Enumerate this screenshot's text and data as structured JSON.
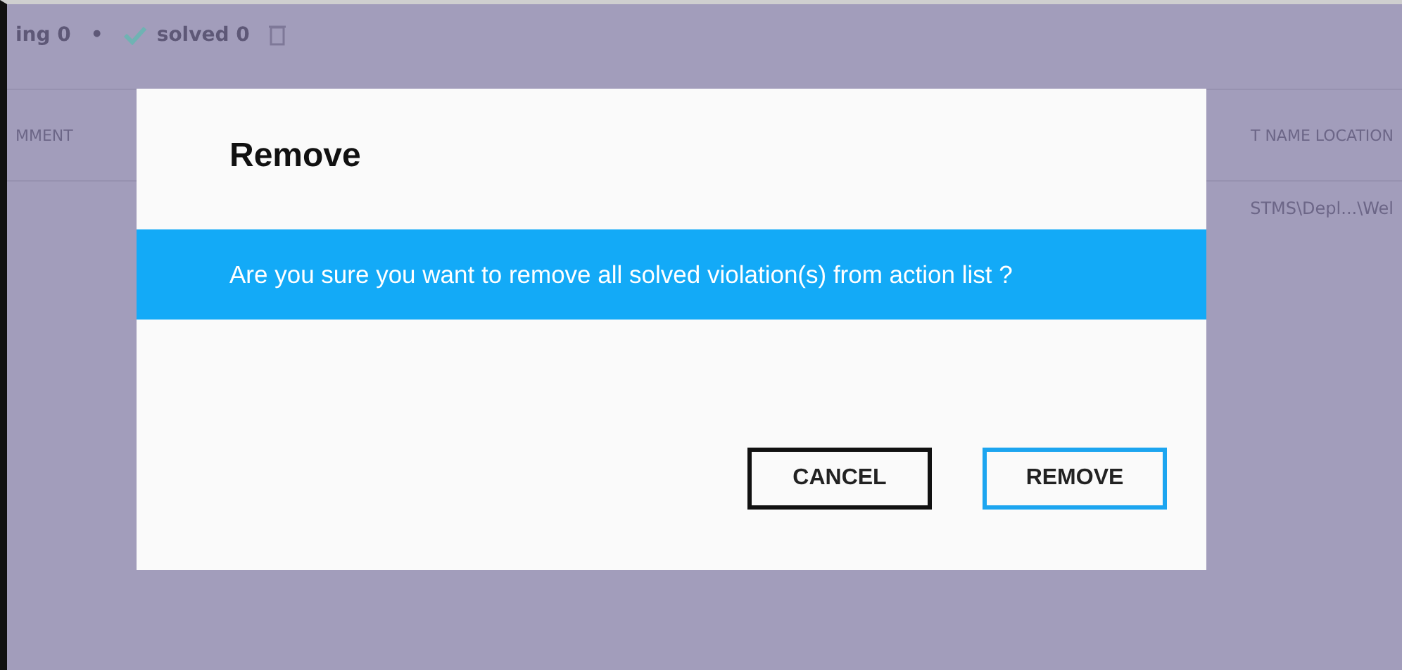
{
  "background": {
    "toolbar": [
      {
        "kind": "count",
        "label": "ing 0"
      },
      {
        "kind": "dot",
        "label": "•"
      },
      {
        "kind": "check",
        "label": "solved 0"
      },
      {
        "kind": "trash"
      }
    ],
    "columns": [
      "MMENT",
      "T NAME LOCATION"
    ],
    "row": [
      "STMS\\Depl...\\Wel"
    ]
  },
  "dialog": {
    "title": "Remove",
    "message": "Are you sure you want to remove all solved violation(s) from action list ?",
    "buttons": [
      {
        "label": "CANCEL",
        "kind": "secondary"
      },
      {
        "label": "REMOVE",
        "kind": "primary"
      }
    ]
  }
}
